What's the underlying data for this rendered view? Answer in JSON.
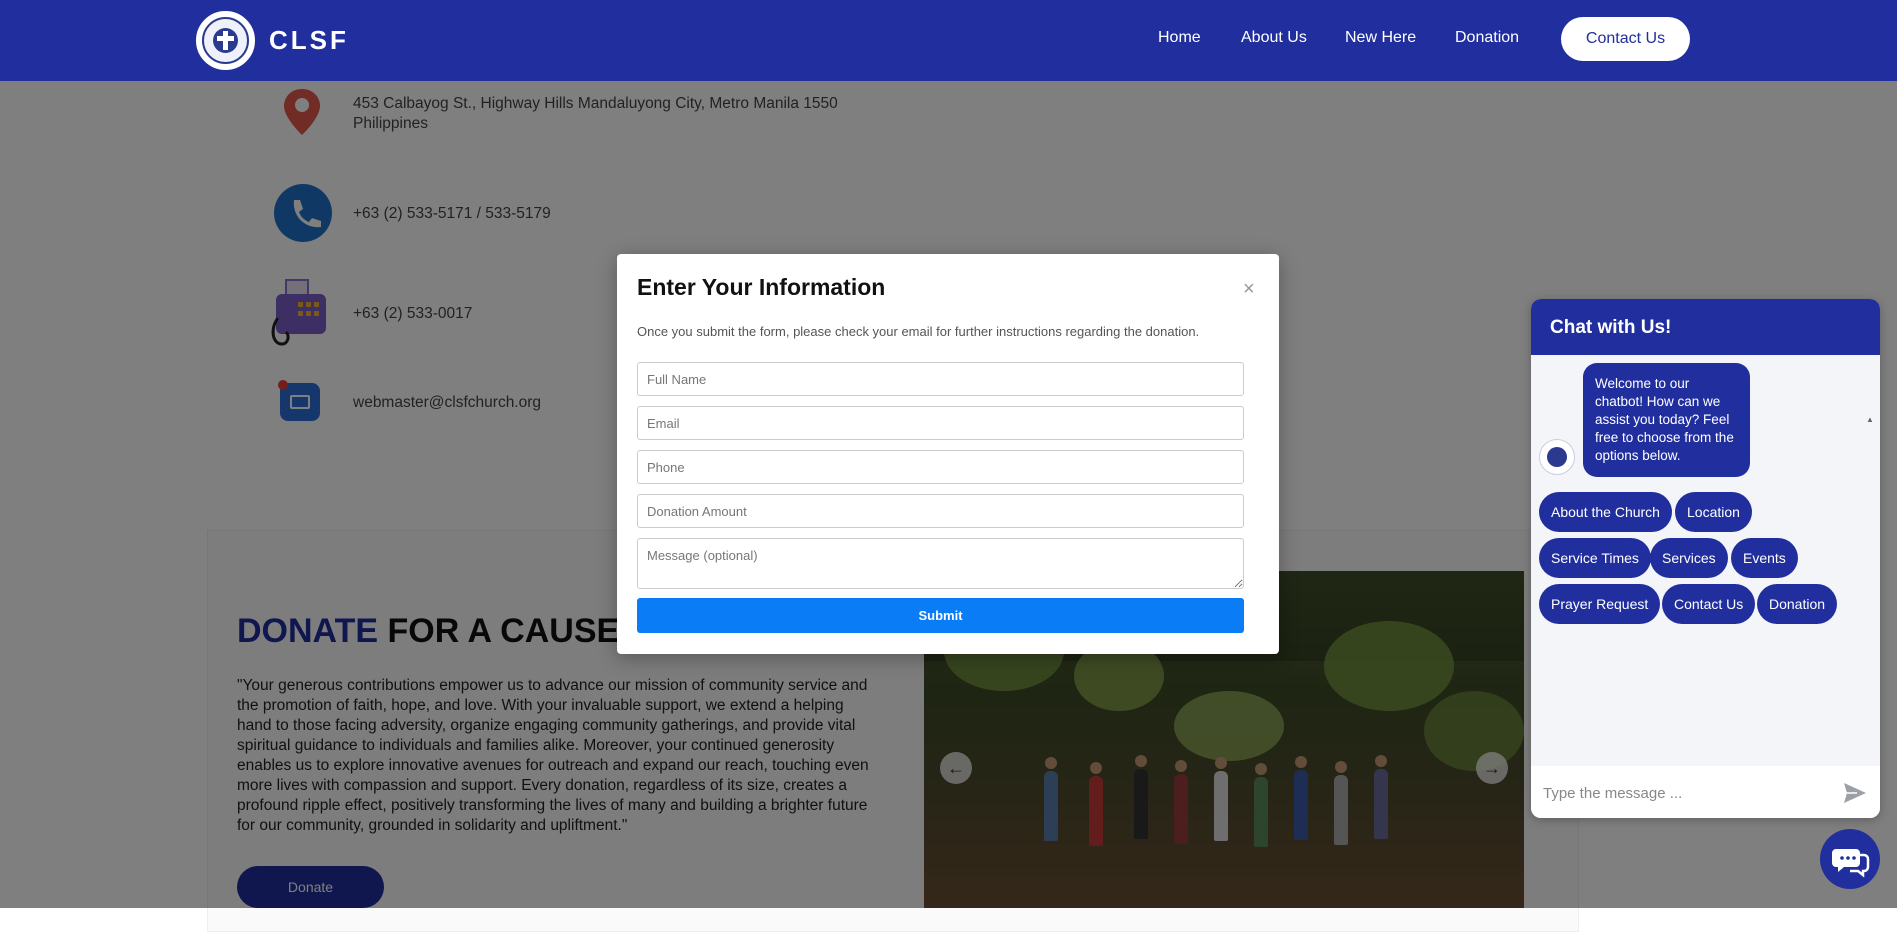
{
  "nav": {
    "brand": "CLSF",
    "links": [
      "Home",
      "About Us",
      "New Here",
      "Donation"
    ],
    "contact_button": "Contact Us"
  },
  "contact_info": {
    "address_line1": "453 Calbayog St., Highway Hills Mandaluyong City, Metro Manila 1550",
    "address_line2": "Philippines",
    "phone": "+63 (2) 533-5171 / 533-5179",
    "fax": "+63 (2) 533-0017",
    "email": "webmaster@clsfchurch.org"
  },
  "donate": {
    "title_accent": "DONATE",
    "title_rest": "FOR A CAUSE",
    "body": "\"Your generous contributions empower us to advance our mission of community service and the promotion of faith, hope, and love. With your invaluable support, we extend a helping hand to those facing adversity, organize engaging community gatherings, and provide vital spiritual guidance to individuals and families alike. Moreover, your continued generosity enables us to explore innovative avenues for outreach and expand our reach, touching even more lives with compassion and support. Every donation, regardless of its size, creates a profound ripple effect, positively transforming the lives of many and building a brighter future for our community, grounded in solidarity and upliftment.\"",
    "button": "Donate"
  },
  "modal": {
    "title": "Enter Your Information",
    "close": "×",
    "note": "Once you submit the form, please check your email for further instructions regarding the donation.",
    "placeholders": {
      "full_name": "Full Name",
      "email": "Email",
      "phone": "Phone",
      "amount": "Donation Amount",
      "message": "Message (optional)"
    },
    "submit": "Submit"
  },
  "chat": {
    "title": "Chat with Us!",
    "welcome": "Welcome to our chatbot! How can we assist you today? Feel free to choose from the options below.",
    "chips": [
      "About the Church",
      "Location",
      "Service Times",
      "Services",
      "Events",
      "Prayer Request",
      "Contact Us",
      "Donation"
    ],
    "input_placeholder": "Type the message ..."
  },
  "colors": {
    "brand_blue": "#212f9e",
    "submit_blue": "#0a7cf5"
  }
}
